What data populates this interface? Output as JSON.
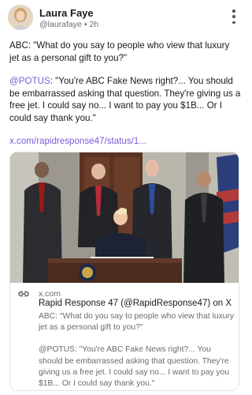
{
  "author": {
    "name": "Laura Faye",
    "handle": "@laurafaye",
    "separator": "•",
    "time": "2h"
  },
  "post": {
    "paragraph1": "ABC: \"What do you say to people who view that luxury jet as a personal gift to you?\"",
    "mention": "@POTUS",
    "paragraph2_rest": ": \"You're ABC Fake News right?... You should be embarrassed asking that question. They're giving us a free jet. I could say no... I want to pay you $1B... Or I could say thank you.\"",
    "link": "x.com/rapidresponse47/status/1..."
  },
  "card": {
    "domain": "x.com",
    "title": "Rapid Response 47 (@RapidResponse47) on X",
    "desc1": "ABC: \"What do you say to people who view that luxury jet as a personal gift to you?\"",
    "desc2": "@POTUS: \"You're ABC Fake News right?... You should be embarrassed asking that question. They're giving us a free jet. I could say no... I want to pay you $1B... Or I could say thank you.\""
  },
  "icons": {
    "more": "more-vertical-icon",
    "link": "link-icon"
  },
  "colors": {
    "accent": "#7b5cd6",
    "muted": "#6b6b6b"
  }
}
